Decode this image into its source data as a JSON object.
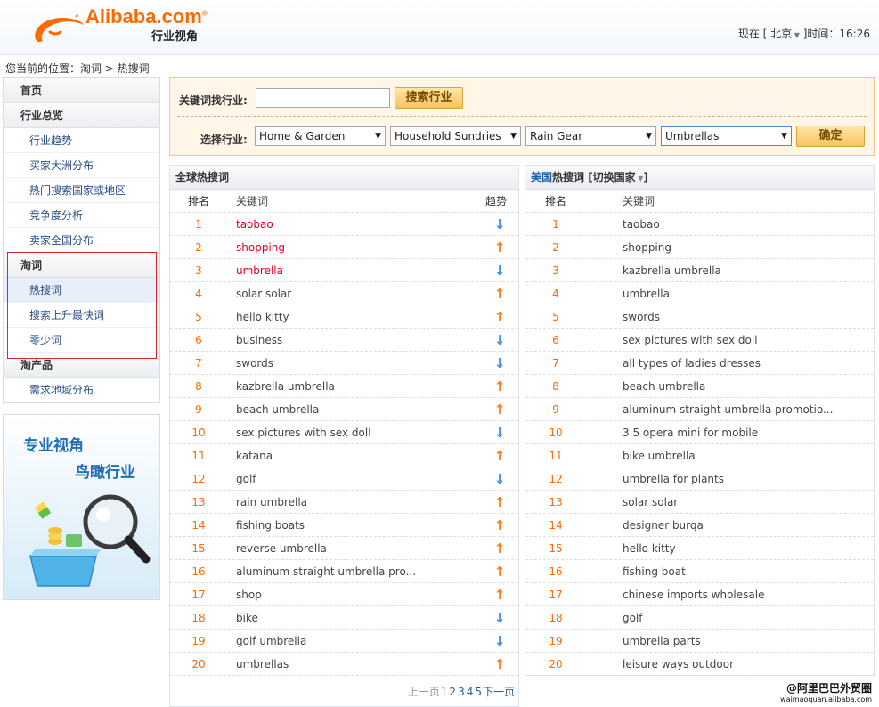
{
  "header": {
    "logo_word": "Alibaba.com",
    "logo_sub": "行业视角",
    "location_prefix": "现在 [",
    "city": "北京",
    "location_suffix": "]",
    "time_label": "时间：",
    "time": "16:26"
  },
  "breadcrumb": "您当前的位置：淘词 > 热搜词",
  "sidebar": {
    "home": "首页",
    "overview": "行业总览",
    "overview_items": [
      "行业趋势",
      "买家大洲分布",
      "热门搜索国家或地区",
      "竞争度分析",
      "卖家全国分布"
    ],
    "taoci": "淘词",
    "taoci_items": [
      "热搜词",
      "搜索上升最快词",
      "零少词"
    ],
    "taochanpin": "淘产品",
    "taochanpin_items": [
      "需求地域分布"
    ],
    "active_item": "热搜词"
  },
  "promo": {
    "line1": "专业视角",
    "line2": "鸟瞰行业"
  },
  "search": {
    "keyword_label": "关键词找行业:",
    "keyword_value": "",
    "search_button": "搜索行业",
    "industry_label": "选择行业:",
    "selects": [
      "Home & Garden",
      "Household Sundries",
      "Rain Gear",
      "Umbrellas"
    ],
    "ok_button": "确定"
  },
  "global_table": {
    "title": "全球热搜词",
    "col_rank": "排名",
    "col_keyword": "关键词",
    "col_trend": "趋势",
    "rows": [
      {
        "rank": "1",
        "keyword": "taobao",
        "trend": "down",
        "highlight": true
      },
      {
        "rank": "2",
        "keyword": "shopping",
        "trend": "up",
        "highlight": true
      },
      {
        "rank": "3",
        "keyword": "umbrella",
        "trend": "down",
        "highlight": true
      },
      {
        "rank": "4",
        "keyword": "solar solar",
        "trend": "up",
        "highlight": false
      },
      {
        "rank": "5",
        "keyword": "hello kitty",
        "trend": "up",
        "highlight": false
      },
      {
        "rank": "6",
        "keyword": "business",
        "trend": "down",
        "highlight": false
      },
      {
        "rank": "7",
        "keyword": "swords",
        "trend": "down",
        "highlight": false
      },
      {
        "rank": "8",
        "keyword": "kazbrella umbrella",
        "trend": "up",
        "highlight": false
      },
      {
        "rank": "9",
        "keyword": "beach umbrella",
        "trend": "up",
        "highlight": false
      },
      {
        "rank": "10",
        "keyword": "sex pictures with sex doll",
        "trend": "down",
        "highlight": false
      },
      {
        "rank": "11",
        "keyword": "katana",
        "trend": "up",
        "highlight": false
      },
      {
        "rank": "12",
        "keyword": "golf",
        "trend": "down",
        "highlight": false
      },
      {
        "rank": "13",
        "keyword": "rain umbrella",
        "trend": "up",
        "highlight": false
      },
      {
        "rank": "14",
        "keyword": "fishing boats",
        "trend": "up",
        "highlight": false
      },
      {
        "rank": "15",
        "keyword": "reverse umbrella",
        "trend": "up",
        "highlight": false
      },
      {
        "rank": "16",
        "keyword": "aluminum straight umbrella pro...",
        "trend": "up",
        "highlight": false
      },
      {
        "rank": "17",
        "keyword": "shop",
        "trend": "up",
        "highlight": false
      },
      {
        "rank": "18",
        "keyword": "bike",
        "trend": "down",
        "highlight": false
      },
      {
        "rank": "19",
        "keyword": "golf umbrella",
        "trend": "down",
        "highlight": false
      },
      {
        "rank": "20",
        "keyword": "umbrellas",
        "trend": "up",
        "highlight": false
      }
    ]
  },
  "us_table": {
    "title_country": "美国",
    "title_rest": "热搜词 [切换国家",
    "title_end": "]",
    "col_rank": "排名",
    "col_keyword": "关键词",
    "rows": [
      {
        "rank": "1",
        "keyword": "taobao"
      },
      {
        "rank": "2",
        "keyword": "shopping"
      },
      {
        "rank": "3",
        "keyword": "kazbrella umbrella"
      },
      {
        "rank": "4",
        "keyword": "umbrella"
      },
      {
        "rank": "5",
        "keyword": "swords"
      },
      {
        "rank": "6",
        "keyword": "sex pictures with sex doll"
      },
      {
        "rank": "7",
        "keyword": "all types of ladies dresses"
      },
      {
        "rank": "8",
        "keyword": "beach umbrella"
      },
      {
        "rank": "9",
        "keyword": "aluminum straight umbrella promotio..."
      },
      {
        "rank": "10",
        "keyword": "3.5 opera mini for mobile"
      },
      {
        "rank": "11",
        "keyword": "bike umbrella"
      },
      {
        "rank": "12",
        "keyword": "umbrella for plants"
      },
      {
        "rank": "13",
        "keyword": "solar solar"
      },
      {
        "rank": "14",
        "keyword": "designer burqa"
      },
      {
        "rank": "15",
        "keyword": "hello kitty"
      },
      {
        "rank": "16",
        "keyword": "fishing boat"
      },
      {
        "rank": "17",
        "keyword": "chinese imports wholesale"
      },
      {
        "rank": "18",
        "keyword": "golf"
      },
      {
        "rank": "19",
        "keyword": "umbrella parts"
      },
      {
        "rank": "20",
        "keyword": "leisure ways outdoor"
      }
    ]
  },
  "pager": {
    "prev": "上一页",
    "pages": [
      "1",
      "2",
      "3",
      "4",
      "5"
    ],
    "current": "1",
    "next": "下一页"
  },
  "watermark": {
    "line1": "@阿里巴巴外贸圈",
    "line2": "waimaoquan.alibaba.com"
  },
  "colors": {
    "accent_orange": "#ff6a00",
    "trend_up": "#ff7b12",
    "trend_down": "#3a8ee6",
    "highlight_red": "#e4002b",
    "link_blue": "#2a4d86",
    "annotation_red": "#d8262b"
  },
  "icons": {
    "trend_up": "arrow-up-icon",
    "trend_down": "arrow-down-icon",
    "select_arrow": "caret-down-icon"
  }
}
